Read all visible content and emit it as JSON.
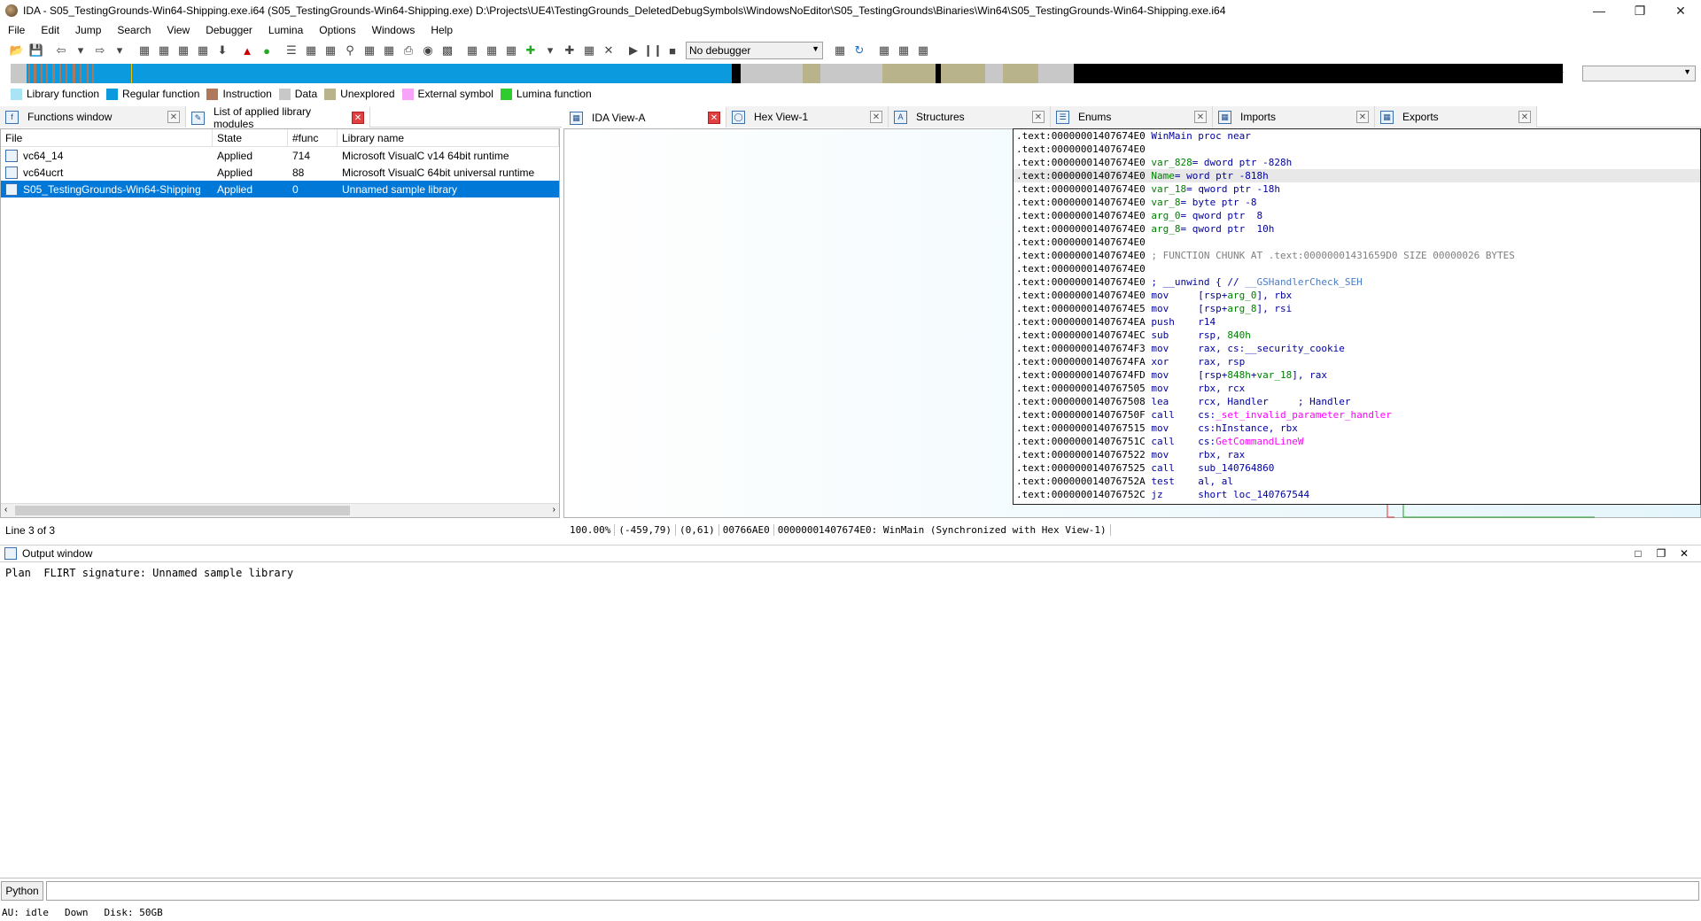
{
  "window": {
    "title": "IDA - S05_TestingGrounds-Win64-Shipping.exe.i64 (S05_TestingGrounds-Win64-Shipping.exe) D:\\Projects\\UE4\\TestingGrounds_DeletedDebugSymbols\\WindowsNoEditor\\S05_TestingGrounds\\Binaries\\Win64\\S05_TestingGrounds-Win64-Shipping.exe.i64"
  },
  "menu": [
    "File",
    "Edit",
    "Jump",
    "Search",
    "View",
    "Debugger",
    "Lumina",
    "Options",
    "Windows",
    "Help"
  ],
  "toolbar": {
    "debugger_label": "No debugger"
  },
  "legend": [
    {
      "label": "Library function",
      "color": "#a8e4f4"
    },
    {
      "label": "Regular function",
      "color": "#0b9ade"
    },
    {
      "label": "Instruction",
      "color": "#b0785a"
    },
    {
      "label": "Data",
      "color": "#c8c8c8"
    },
    {
      "label": "Unexplored",
      "color": "#b8b38a"
    },
    {
      "label": "External symbol",
      "color": "#f7a3f7"
    },
    {
      "label": "Lumina function",
      "color": "#2ecc2e"
    }
  ],
  "left_tabs": [
    {
      "label": "Functions window",
      "active": false
    },
    {
      "label": "List of applied library modules",
      "active": true
    }
  ],
  "right_tabs": [
    {
      "label": "IDA View-A",
      "active": true
    },
    {
      "label": "Hex View-1",
      "active": false
    },
    {
      "label": "Structures",
      "active": false
    },
    {
      "label": "Enums",
      "active": false
    },
    {
      "label": "Imports",
      "active": false
    },
    {
      "label": "Exports",
      "active": false
    }
  ],
  "library_table": {
    "headers": [
      "File",
      "State",
      "#func",
      "Library name"
    ],
    "rows": [
      {
        "file": "vc64_14",
        "state": "Applied",
        "func": "714",
        "name": "Microsoft VisualC v14 64bit runtime",
        "selected": false
      },
      {
        "file": "vc64ucrt",
        "state": "Applied",
        "func": "88",
        "name": "Microsoft VisualC 64bit universal runtime",
        "selected": false
      },
      {
        "file": "S05_TestingGrounds-Win64-Shipping",
        "state": "Applied",
        "func": "0",
        "name": "Unnamed sample library",
        "selected": true
      }
    ],
    "status": "Line 3 of 3"
  },
  "disasm": [
    [
      {
        "t": ".text:00000001407674E0 ",
        "c": "seg"
      },
      {
        "t": "WinMain proc near",
        "c": "blue"
      }
    ],
    [
      {
        "t": ".text:00000001407674E0",
        "c": "seg"
      }
    ],
    [
      {
        "t": ".text:00000001407674E0 ",
        "c": "seg"
      },
      {
        "t": "var_828",
        "c": "green"
      },
      {
        "t": "= dword ptr -828h",
        "c": "blue"
      }
    ],
    [
      {
        "t": ".text:00000001407674E0 ",
        "c": "seg"
      },
      {
        "t": "Name",
        "c": "green"
      },
      {
        "t": "= word ptr -818h",
        "c": "blue"
      }
    ],
    [
      {
        "t": ".text:00000001407674E0 ",
        "c": "seg"
      },
      {
        "t": "var_18",
        "c": "green"
      },
      {
        "t": "= qword ptr -18h",
        "c": "blue"
      }
    ],
    [
      {
        "t": ".text:00000001407674E0 ",
        "c": "seg"
      },
      {
        "t": "var_8",
        "c": "green"
      },
      {
        "t": "= byte ptr -8",
        "c": "blue"
      }
    ],
    [
      {
        "t": ".text:00000001407674E0 ",
        "c": "seg"
      },
      {
        "t": "arg_0",
        "c": "green"
      },
      {
        "t": "= qword ptr  8",
        "c": "blue"
      }
    ],
    [
      {
        "t": ".text:00000001407674E0 ",
        "c": "seg"
      },
      {
        "t": "arg_8",
        "c": "green"
      },
      {
        "t": "= qword ptr  10h",
        "c": "blue"
      }
    ],
    [
      {
        "t": ".text:00000001407674E0",
        "c": "seg"
      }
    ],
    [
      {
        "t": ".text:00000001407674E0 ",
        "c": "seg"
      },
      {
        "t": "; FUNCTION CHUNK AT .text:00000001431659D0 SIZE 00000026 BYTES",
        "c": "gray"
      }
    ],
    [
      {
        "t": ".text:00000001407674E0",
        "c": "seg"
      }
    ],
    [
      {
        "t": ".text:00000001407674E0 ",
        "c": "seg"
      },
      {
        "t": "; __unwind { // ",
        "c": "blue"
      },
      {
        "t": "__GSHandlerCheck_SEH",
        "c": "lightblue"
      }
    ],
    [
      {
        "t": ".text:00000001407674E0 ",
        "c": "seg"
      },
      {
        "t": "mov     [rsp+",
        "c": "blue"
      },
      {
        "t": "arg_0",
        "c": "green"
      },
      {
        "t": "], rbx",
        "c": "blue"
      }
    ],
    [
      {
        "t": ".text:00000001407674E5 ",
        "c": "seg"
      },
      {
        "t": "mov     [rsp+",
        "c": "blue"
      },
      {
        "t": "arg_8",
        "c": "green"
      },
      {
        "t": "], rsi",
        "c": "blue"
      }
    ],
    [
      {
        "t": ".text:00000001407674EA ",
        "c": "seg"
      },
      {
        "t": "push    r14",
        "c": "blue"
      }
    ],
    [
      {
        "t": ".text:00000001407674EC ",
        "c": "seg"
      },
      {
        "t": "sub     rsp, ",
        "c": "blue"
      },
      {
        "t": "840h",
        "c": "green"
      }
    ],
    [
      {
        "t": ".text:00000001407674F3 ",
        "c": "seg"
      },
      {
        "t": "mov     rax, cs:",
        "c": "blue"
      },
      {
        "t": "__security_cookie",
        "c": "blue"
      }
    ],
    [
      {
        "t": ".text:00000001407674FA ",
        "c": "seg"
      },
      {
        "t": "xor     rax, rsp",
        "c": "blue"
      }
    ],
    [
      {
        "t": ".text:00000001407674FD ",
        "c": "seg"
      },
      {
        "t": "mov     [rsp+",
        "c": "blue"
      },
      {
        "t": "848h",
        "c": "green"
      },
      {
        "t": "+",
        "c": "blue"
      },
      {
        "t": "var_18",
        "c": "green"
      },
      {
        "t": "], rax",
        "c": "blue"
      }
    ],
    [
      {
        "t": ".text:0000000140767505 ",
        "c": "seg"
      },
      {
        "t": "mov     rbx, rcx",
        "c": "blue"
      }
    ],
    [
      {
        "t": ".text:0000000140767508 ",
        "c": "seg"
      },
      {
        "t": "lea     rcx, Handler     ",
        "c": "blue"
      },
      {
        "t": "; Handler",
        "c": "blue"
      }
    ],
    [
      {
        "t": ".text:000000014076750F ",
        "c": "seg"
      },
      {
        "t": "call    cs:",
        "c": "blue"
      },
      {
        "t": "_set_invalid_parameter_handler",
        "c": "magenta"
      }
    ],
    [
      {
        "t": ".text:0000000140767515 ",
        "c": "seg"
      },
      {
        "t": "mov     cs:hInstance, rbx",
        "c": "blue"
      }
    ],
    [
      {
        "t": ".text:000000014076751C ",
        "c": "seg"
      },
      {
        "t": "call    cs:",
        "c": "blue"
      },
      {
        "t": "GetCommandLineW",
        "c": "magenta"
      }
    ],
    [
      {
        "t": ".text:0000000140767522 ",
        "c": "seg"
      },
      {
        "t": "mov     rbx, rax",
        "c": "blue"
      }
    ],
    [
      {
        "t": ".text:0000000140767525 ",
        "c": "seg"
      },
      {
        "t": "call    sub_140764860",
        "c": "blue"
      }
    ],
    [
      {
        "t": ".text:000000014076752A ",
        "c": "seg"
      },
      {
        "t": "test    al, al",
        "c": "blue"
      }
    ],
    [
      {
        "t": ".text:000000014076752C ",
        "c": "seg"
      },
      {
        "t": "jz      short loc_140767544",
        "c": "blue"
      }
    ]
  ],
  "ida_status": [
    "100.00%",
    "(-459,79)",
    "(0,61)",
    "00766AE0",
    "00000001407674E0: WinMain (Synchronized with Hex View-1)"
  ],
  "output": {
    "title": "Output window",
    "text": "Plan  FLIRT signature: Unnamed sample library"
  },
  "python_label": "Python",
  "statusbar": {
    "au": "AU:  idle",
    "dir": "Down",
    "disk": "Disk: 50GB"
  }
}
